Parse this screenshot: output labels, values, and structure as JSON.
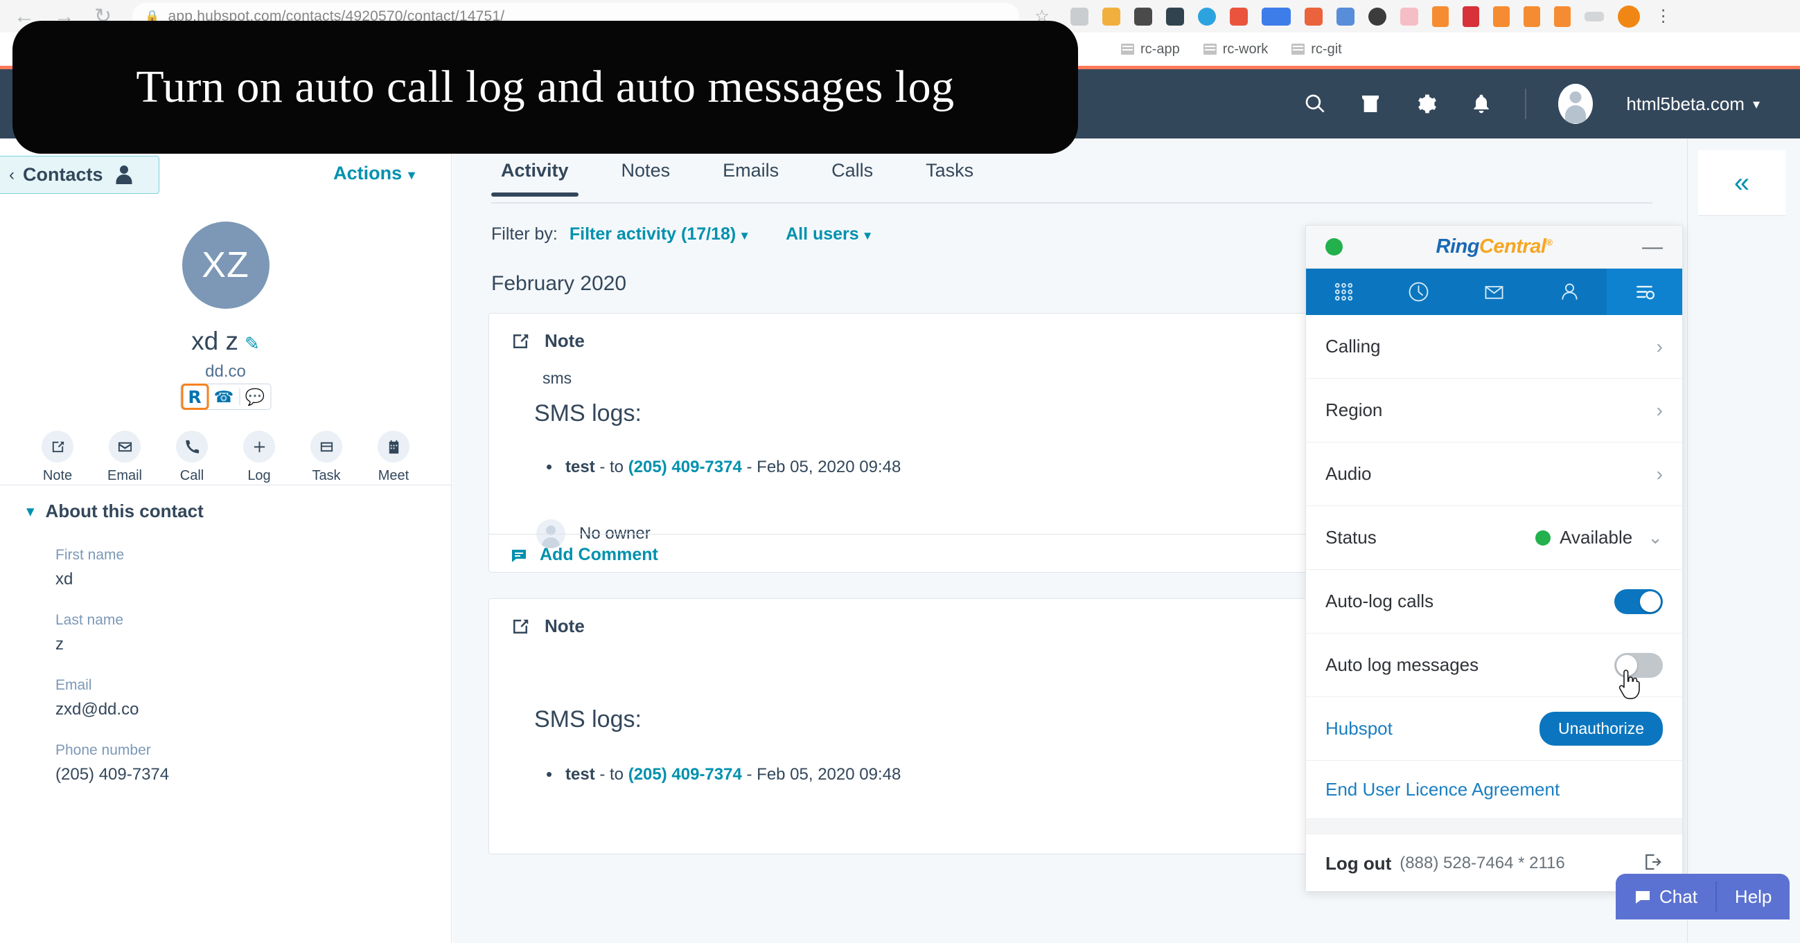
{
  "caption": {
    "text": "Turn on auto call log and auto messages log"
  },
  "browser": {
    "url": "app.hubspot.com/contacts/4920570/contact/14751/",
    "nav_icons": [
      "back-arrow",
      "forward-arrow",
      "reload"
    ],
    "bookmarks": [
      {
        "label": "rc-app",
        "icon": "folder-icon"
      },
      {
        "label": "rc-work",
        "icon": "folder-icon"
      },
      {
        "label": "rc-git",
        "icon": "folder-icon"
      }
    ]
  },
  "hubspot_nav": {
    "icons": [
      "search-icon",
      "marketplace-icon",
      "gear-icon",
      "bell-icon"
    ],
    "account": "html5beta.com",
    "accent_color": "#ff7a59",
    "bar_color": "#33475b"
  },
  "contact_panel": {
    "back_label": "Contacts",
    "actions_label": "Actions",
    "avatar_initials": "XZ",
    "name": "xd z",
    "domain": "dd.co",
    "rc_buttons": [
      "ringcentral-logo",
      "phone-icon",
      "sms-icon"
    ],
    "quick_actions": [
      {
        "label": "Note",
        "icon": "note-icon"
      },
      {
        "label": "Email",
        "icon": "email-icon"
      },
      {
        "label": "Call",
        "icon": "phone-icon"
      },
      {
        "label": "Log",
        "icon": "plus-icon"
      },
      {
        "label": "Task",
        "icon": "task-icon"
      },
      {
        "label": "Meet",
        "icon": "calendar-icon"
      }
    ],
    "about_title": "About this contact",
    "fields": [
      {
        "key": "First name",
        "value": "xd"
      },
      {
        "key": "Last name",
        "value": "z"
      },
      {
        "key": "Email",
        "value": "zxd@dd.co"
      },
      {
        "key": "Phone number",
        "value": "(205) 409-7374"
      }
    ]
  },
  "main": {
    "tabs": [
      {
        "label": "Activity",
        "active": true
      },
      {
        "label": "Notes",
        "active": false
      },
      {
        "label": "Emails",
        "active": false
      },
      {
        "label": "Calls",
        "active": false
      },
      {
        "label": "Tasks",
        "active": false
      }
    ],
    "filter_label": "Filter by:",
    "filter_activity": "Filter activity (17/18)",
    "filter_users": "All users",
    "month": "February 2020",
    "notes": [
      {
        "type": "Note",
        "body": "sms",
        "heading": "SMS logs:",
        "entry_prefix": "test",
        "entry_mid": " - to ",
        "entry_phone": "(205) 409-7374",
        "entry_suffix": " - Feb 05, 2020 09:48",
        "owner": "No owner",
        "comment_label": "Add Comment"
      },
      {
        "type": "Note",
        "body": "",
        "heading": "SMS logs:",
        "entry_prefix": "test",
        "entry_mid": " - to ",
        "entry_phone": "(205) 409-7374",
        "entry_suffix": " - Feb 05, 2020 09:48",
        "owner": "",
        "comment_label": ""
      }
    ]
  },
  "right_rail": {
    "collapse_icon": "«"
  },
  "ringcentral": {
    "logo_ring": "Ring",
    "logo_central": "Central",
    "presence_color": "#22b14c",
    "minimize_icon": "—",
    "tabs": [
      {
        "name": "dialpad-tab",
        "active": false
      },
      {
        "name": "history-tab",
        "active": false
      },
      {
        "name": "messages-tab",
        "active": false
      },
      {
        "name": "contacts-tab",
        "active": false
      },
      {
        "name": "settings-tab",
        "active": true
      }
    ],
    "rows": [
      {
        "label": "Calling",
        "control": "chevron-right"
      },
      {
        "label": "Region",
        "control": "chevron-right"
      },
      {
        "label": "Audio",
        "control": "chevron-right"
      }
    ],
    "status_label": "Status",
    "status_value": "Available",
    "autolog_calls_label": "Auto-log calls",
    "autolog_calls_on": true,
    "autolog_messages_label": "Auto log messages",
    "autolog_messages_on": false,
    "hubspot_label": "Hubspot",
    "unauthorize_label": "Unauthorize",
    "eula_label": "End User Licence Agreement",
    "logout_label": "Log out",
    "logout_ext": "(888) 528-7464 * 2116",
    "accent_color": "#0b76bf"
  },
  "chat_widget": {
    "chat_label": "Chat",
    "help_label": "Help",
    "color": "#5c72d2"
  }
}
